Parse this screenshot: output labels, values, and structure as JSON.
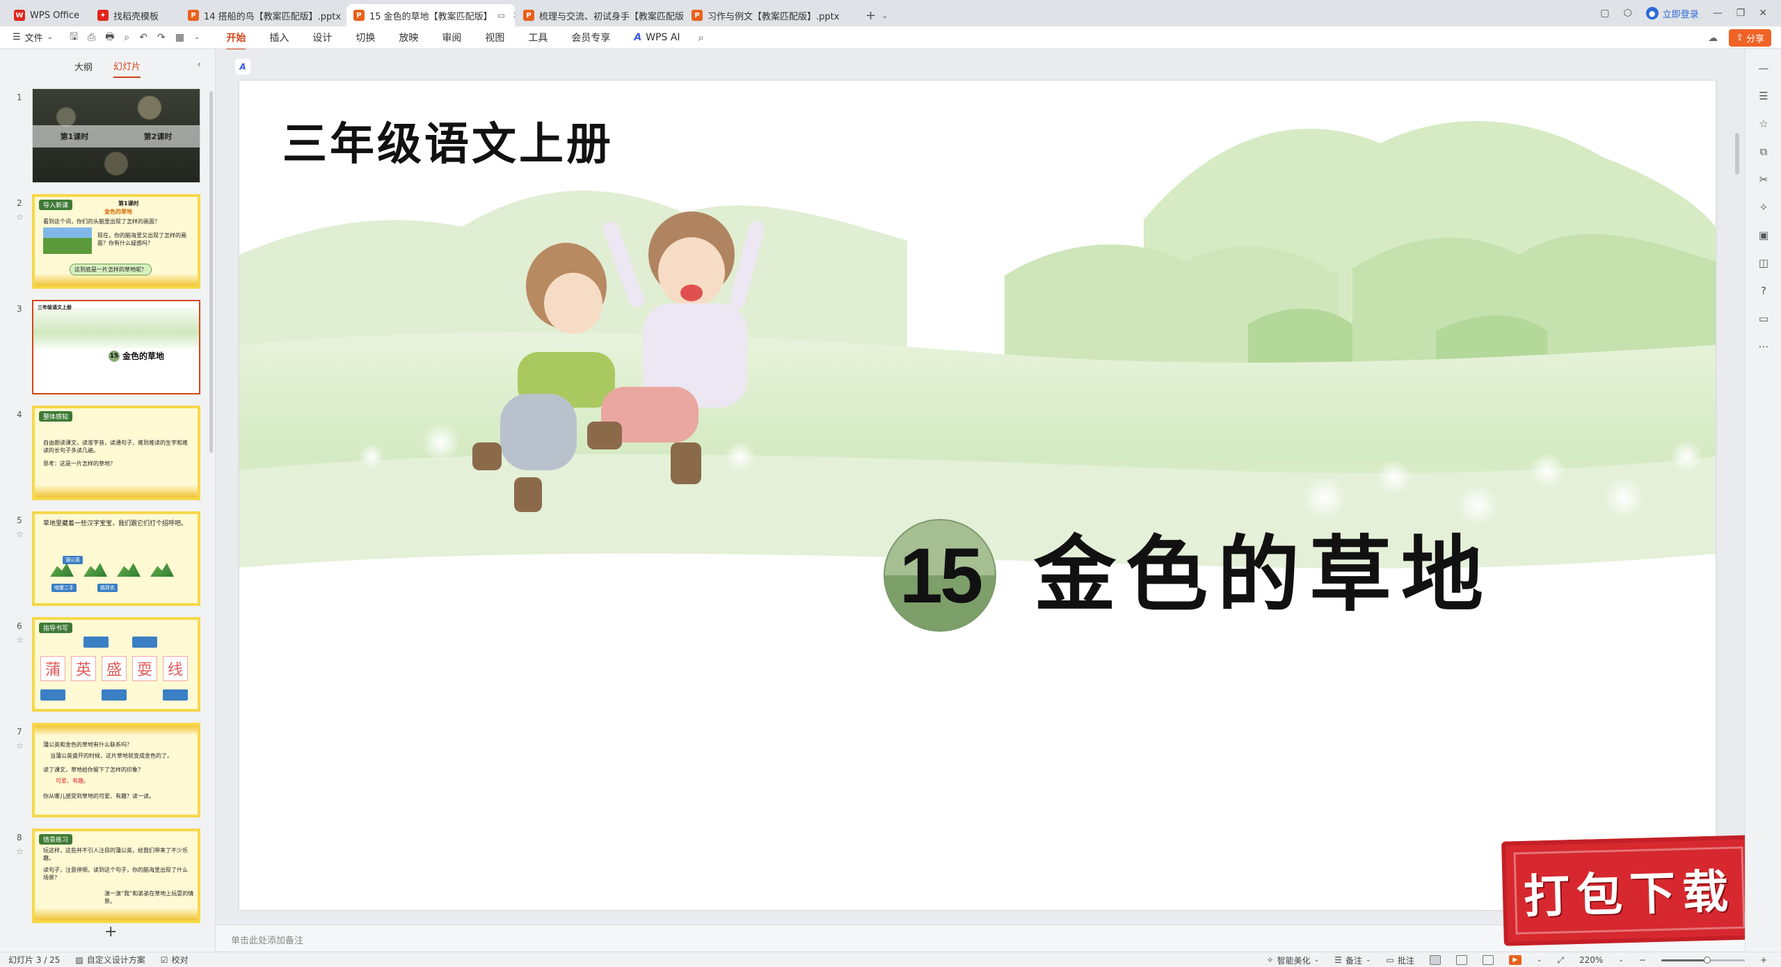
{
  "tabs": [
    {
      "label": "WPS Office",
      "icon": "wps-logo-icon",
      "active": false
    },
    {
      "label": "找稻壳模板",
      "icon": "template-icon",
      "active": false
    },
    {
      "label": "14 搭船的鸟【教案匹配版】.pptx",
      "icon": "ppt-file-icon",
      "active": false
    },
    {
      "label": "15 金色的草地【教案匹配版】",
      "icon": "ppt-file-icon",
      "active": true
    },
    {
      "label": "梳理与交流、初试身手【教案匹配版】",
      "icon": "ppt-file-icon",
      "active": false
    },
    {
      "label": "习作与例文【教案匹配版】.pptx",
      "icon": "ppt-file-icon",
      "active": false
    }
  ],
  "tab_icon_glyphs": {
    "wps": "W",
    "ppt": "P",
    "template": "✦"
  },
  "login_label": "立即登录",
  "share_label": "分享",
  "file_menu_label": "文件",
  "menu": [
    "开始",
    "插入",
    "设计",
    "切换",
    "放映",
    "审阅",
    "视图",
    "工具",
    "会员专享"
  ],
  "active_menu": "开始",
  "wps_ai_label": "WPS AI",
  "panel_tabs": {
    "outline": "大纲",
    "slides": "幻灯片"
  },
  "thumbnails": [
    {
      "num": "1",
      "bar": [
        "第1课时",
        "第2课时"
      ]
    },
    {
      "num": "2",
      "tag": "导入新课",
      "lines": [
        "第1课时",
        "金色的草地",
        "看到这个词，你们的头脑里出现了怎样的画面？",
        "现在，你的脑海里又出现了怎样的画面？你有什么疑惑吗？",
        "这到底是一片怎样的草地呢？"
      ]
    },
    {
      "num": "3",
      "title": "三年级语文上册",
      "sub_num": "15",
      "sub": "金色的草地"
    },
    {
      "num": "4",
      "tag": "整体感知",
      "lines": [
        "自由朗读课文，读准字音，读通句子，难到难读的生字和难读的长句子多读几遍。",
        "思考：这是一片怎样的草地？"
      ]
    },
    {
      "num": "5",
      "lines": [
        "草地里藏着一些汉字宝宝，我们跟它们打个招呼吧。"
      ],
      "chips": [
        "蒲公英",
        "喧腹二手",
        "揣荷衣"
      ]
    },
    {
      "num": "6",
      "tag": "指导书写",
      "chars": [
        "蒲",
        "英",
        "盛",
        "耍",
        "线"
      ]
    },
    {
      "num": "7",
      "lines": [
        "蒲公英和金色的草地有什么联系吗？",
        "当蒲公英盛开的时候，这片草地就变成金色的了。",
        "读了课文，草地给你留下了怎样的印象？",
        "可爱、有趣。",
        "你从哪儿感受到草地的可爱、有趣？读一读。"
      ]
    },
    {
      "num": "8",
      "tag": "情景练习",
      "lines": [
        "玩这样，这些并不引人注目的蒲公英，给我们带来了不少乐趣。",
        "读句子，注意停顿。读到这个句子，你的脑海里出现了什么场景？",
        "演一演“我”和弟弟在草地上玩耍的情景。"
      ]
    }
  ],
  "slide": {
    "title": "三年级语文上册",
    "lesson_number": "15",
    "lesson_title": "金色的草地"
  },
  "download_stamp": "打包下载",
  "notes_placeholder": "单击此处添加备注",
  "status": {
    "slide_counter": "幻灯片 3 / 25",
    "design_scheme": "自定义设计方案",
    "proofread": "校对",
    "beautify": "智能美化",
    "notes": "备注",
    "comments": "批注",
    "zoom": "220%",
    "zoom_fraction": 0.55
  },
  "colors": {
    "accent": "#d2451b",
    "share": "#f06226",
    "stamp": "#d7282f",
    "circle_top": "#a5bf93",
    "circle_bottom": "#7d9f6a"
  }
}
